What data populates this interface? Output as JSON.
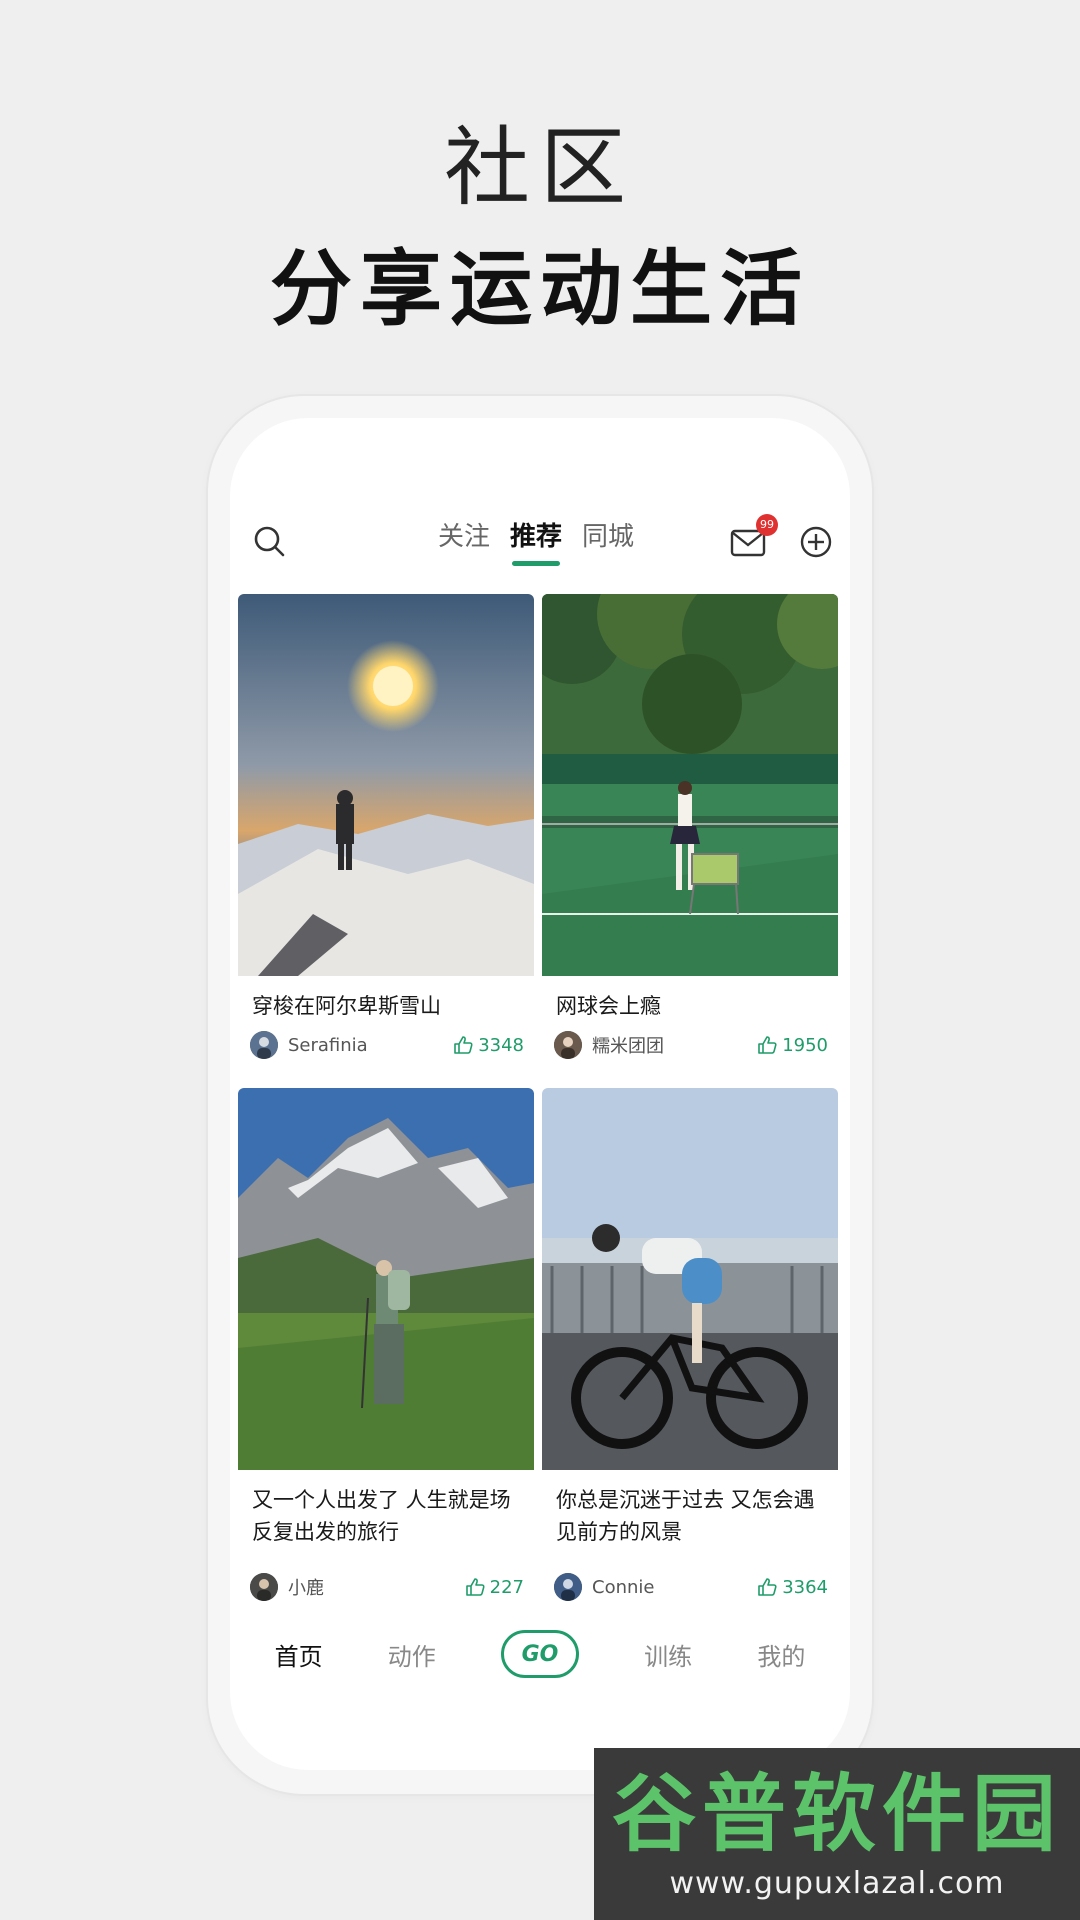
{
  "headline": {
    "line1": "社区",
    "line2": "分享运动生活"
  },
  "topbar": {
    "tabs": [
      {
        "label": "关注"
      },
      {
        "label": "推荐"
      },
      {
        "label": "同城"
      }
    ],
    "active_tab": "推荐",
    "message_badge": "99"
  },
  "feed": {
    "cards": [
      {
        "title": "穿梭在阿尔卑斯雪山",
        "user": "Serafinia",
        "likes": "3348"
      },
      {
        "title": "网球会上瘾",
        "user": "糯米团团",
        "likes": "1950"
      },
      {
        "title": "又一个人出发了 人生就是场反复出发的旅行",
        "user": "小鹿",
        "likes": "227"
      },
      {
        "title": "你总是沉迷于过去 又怎会遇见前方的风景",
        "user": "Connie",
        "likes": "3364"
      }
    ]
  },
  "bottom_nav": {
    "items": [
      {
        "label": "首页"
      },
      {
        "label": "动作"
      },
      {
        "label": "GO"
      },
      {
        "label": "训练"
      },
      {
        "label": "我的"
      }
    ]
  },
  "watermark": {
    "title": "谷普软件园",
    "url": "www.gupuxlazal.com"
  },
  "colors": {
    "accent": "#1f9c6a",
    "badge": "#e03131"
  }
}
